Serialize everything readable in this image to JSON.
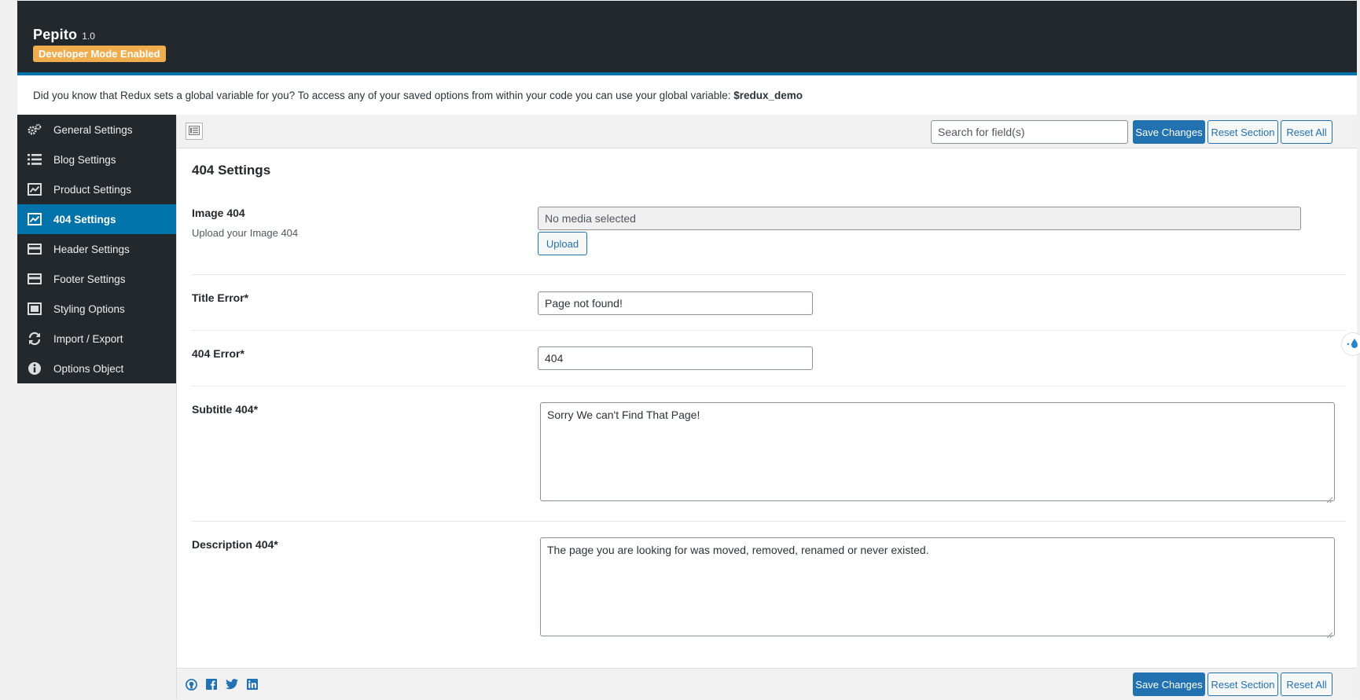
{
  "header": {
    "app_name": "Pepito",
    "version": "1.0",
    "badge": "Developer Mode Enabled"
  },
  "notice": {
    "text": "Did you know that Redux sets a global variable for you? To access any of your saved options from within your code you can use your global variable: ",
    "variable": "$redux_demo"
  },
  "sidebar": {
    "items": [
      {
        "label": "General Settings",
        "icon": "gears-icon"
      },
      {
        "label": "Blog Settings",
        "icon": "list-icon"
      },
      {
        "label": "Product Settings",
        "icon": "chart-icon"
      },
      {
        "label": "404 Settings",
        "icon": "chart-icon",
        "active": true
      },
      {
        "label": "Header Settings",
        "icon": "card-icon"
      },
      {
        "label": "Footer Settings",
        "icon": "card-icon"
      },
      {
        "label": "Styling Options",
        "icon": "window-icon"
      },
      {
        "label": "Import / Export",
        "icon": "refresh-icon"
      },
      {
        "label": "Options Object",
        "icon": "info-icon"
      }
    ]
  },
  "toolbar": {
    "search_placeholder": "Search for field(s)",
    "save_label": "Save Changes",
    "reset_section_label": "Reset Section",
    "reset_all_label": "Reset All"
  },
  "section": {
    "title": "404 Settings",
    "image_field": {
      "label": "Image 404",
      "description": "Upload your Image 404",
      "value": "No media selected",
      "upload_label": "Upload"
    },
    "title_error": {
      "label": "Title Error*",
      "value": "Page not found!"
    },
    "error_404": {
      "label": "404 Error*",
      "value": "404"
    },
    "subtitle_404": {
      "label": "Subtitle 404*",
      "value": "Sorry We can't Find That Page!"
    },
    "description_404": {
      "label": "Description 404*",
      "value": "The page you are looking for was moved, removed, renamed or never existed."
    }
  },
  "footer": {
    "social_icons": [
      "github-icon",
      "facebook-icon",
      "twitter-icon",
      "linkedin-icon"
    ],
    "save_label": "Save Changes",
    "reset_section_label": "Reset Section",
    "reset_all_label": "Reset All"
  },
  "colors": {
    "topbar": "#23282d",
    "accent": "#0073aa",
    "badge": "#f0ad4e",
    "primary_button": "#2271b1"
  }
}
